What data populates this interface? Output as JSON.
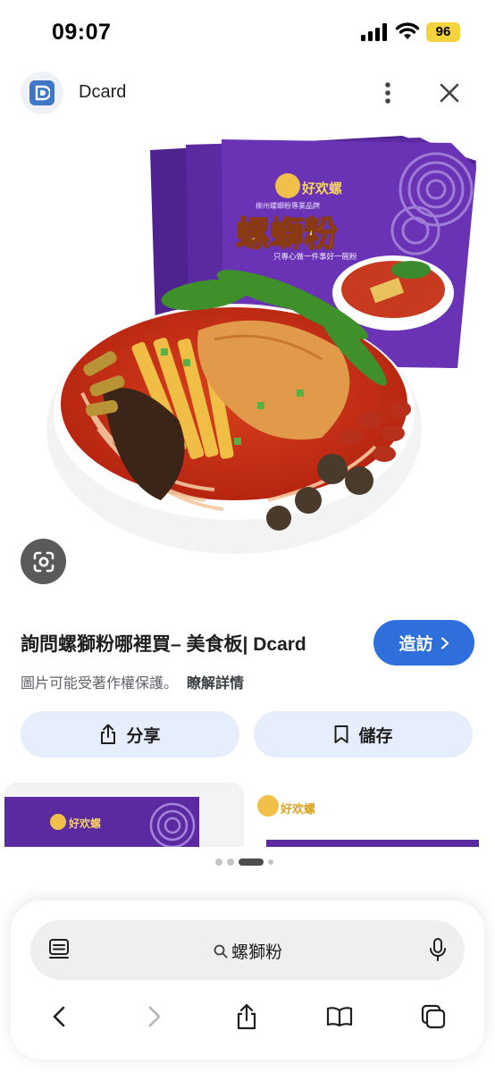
{
  "status_bar": {
    "time": "09:07",
    "battery": "96"
  },
  "header": {
    "site_name": "Dcard"
  },
  "hero": {
    "package_brand": "好欢螺",
    "package_product": "螺螄粉",
    "package_slogan": "只專心做一件事好一碗粉",
    "package_top_text": "柳州螺螄粉專業品牌"
  },
  "result": {
    "title": "詢問螺獅粉哪裡買– 美食板| Dcard",
    "visit_label": "造訪",
    "copyright": "圖片可能受著作權保護。",
    "learn_more": "瞭解詳情"
  },
  "actions": {
    "share_label": "分享",
    "save_label": "儲存"
  },
  "related": {
    "thumb1_brand": "好欢螺",
    "thumb2_brand": "好欢螺"
  },
  "toolbar": {
    "search_query": "螺獅粉"
  },
  "colors": {
    "accent": "#2f6fdc",
    "action_bg": "#e7eefb",
    "battery": "#f5d33f",
    "package_purple": "#5b2aa0"
  }
}
